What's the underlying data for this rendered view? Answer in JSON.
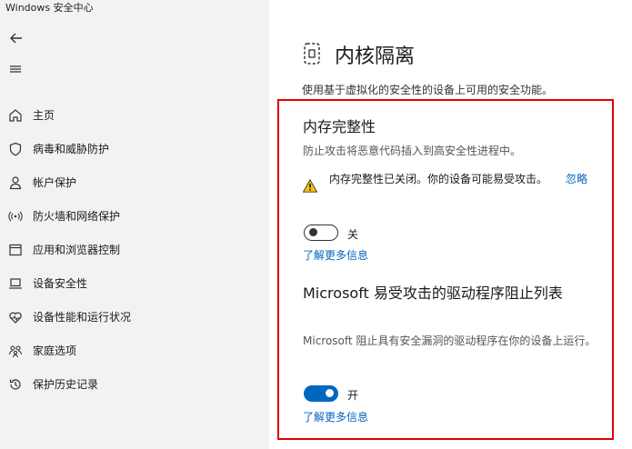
{
  "window": {
    "title": "Windows 安全中心"
  },
  "sidebar": {
    "items": [
      {
        "label": "主页",
        "icon": "home-icon"
      },
      {
        "label": "病毒和威胁防护",
        "icon": "shield-icon"
      },
      {
        "label": "帐户保护",
        "icon": "person-icon"
      },
      {
        "label": "防火墙和网络保护",
        "icon": "wifi-icon"
      },
      {
        "label": "应用和浏览器控制",
        "icon": "app-window-icon"
      },
      {
        "label": "设备安全性",
        "icon": "laptop-icon"
      },
      {
        "label": "设备性能和运行状况",
        "icon": "heart-icon"
      },
      {
        "label": "家庭选项",
        "icon": "family-icon"
      },
      {
        "label": "保护历史记录",
        "icon": "history-icon"
      }
    ]
  },
  "main": {
    "title": "内核隔离",
    "description": "使用基于虚拟化的安全性的设备上可用的安全功能。",
    "memory_integrity": {
      "title": "内存完整性",
      "description": "防止攻击将恶意代码插入到高安全性进程中。",
      "warning": "内存完整性已关闭。你的设备可能易受攻击。",
      "dismiss": "忽略",
      "toggle_state": "关",
      "toggle_on": false,
      "learn_more": "了解更多信息"
    },
    "driver_blocklist": {
      "title": "Microsoft 易受攻击的驱动程序阻止列表",
      "description": "Microsoft 阻止具有安全漏洞的驱动程序在你的设备上运行。",
      "toggle_state": "开",
      "toggle_on": true,
      "learn_more": "了解更多信息"
    }
  },
  "colors": {
    "accent": "#0067c0",
    "highlight_box": "#e00000",
    "warning": "#f7c600",
    "sidebar_bg": "#f2f2f2"
  }
}
